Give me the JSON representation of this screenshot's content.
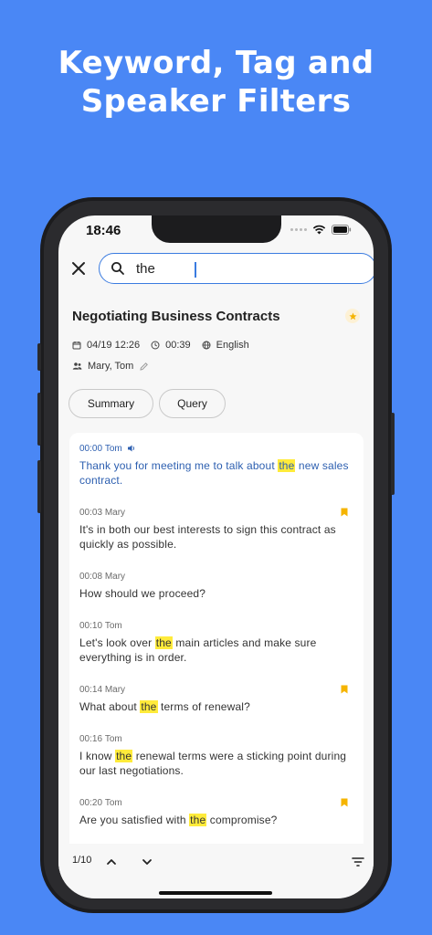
{
  "headline": {
    "line1": "Keyword, Tag and",
    "line2": "Speaker Filters"
  },
  "status_bar": {
    "time": "18:46"
  },
  "search": {
    "value": "the",
    "placeholder": ""
  },
  "document": {
    "title": "Negotiating Business Contracts",
    "date": "04/19 12:26",
    "duration": "00:39",
    "language": "English",
    "speakers": "Mary, Tom"
  },
  "tabs": [
    {
      "label": "Summary"
    },
    {
      "label": "Query"
    }
  ],
  "transcript": [
    {
      "time": "00:00",
      "speaker": "Tom",
      "pre": "Thank you for meeting me to talk about ",
      "match": "the",
      "post": " new sales contract.",
      "playing": true,
      "bookmarked": false
    },
    {
      "time": "00:03",
      "speaker": "Mary",
      "pre": "It's in both our best interests to sign this contract as quickly as possible.",
      "match": "",
      "post": "",
      "playing": false,
      "bookmarked": true
    },
    {
      "time": "00:08",
      "speaker": "Mary",
      "pre": "How should we proceed?",
      "match": "",
      "post": "",
      "playing": false,
      "bookmarked": false
    },
    {
      "time": "00:10",
      "speaker": "Tom",
      "pre": "Let's look over ",
      "match": "the",
      "post": " main articles and make sure everything is in order.",
      "playing": false,
      "bookmarked": false
    },
    {
      "time": "00:14",
      "speaker": "Mary",
      "pre": "What about ",
      "match": "the",
      "post": " terms of renewal?",
      "playing": false,
      "bookmarked": true
    },
    {
      "time": "00:16",
      "speaker": "Tom",
      "pre": "I know ",
      "match": "the",
      "post": " renewal terms were a sticking point during our last negotiations.",
      "playing": false,
      "bookmarked": false
    },
    {
      "time": "00:20",
      "speaker": "Tom",
      "pre": "Are you satisfied with ",
      "match": "the",
      "post": " compromise?",
      "playing": false,
      "bookmarked": true
    }
  ],
  "footer": {
    "page_counter": "1/10"
  },
  "colors": {
    "background": "#4a87f5",
    "accent": "#3a7be0",
    "highlight": "#ffeb3b",
    "bookmark": "#f5b400",
    "active_text": "#2d5fb0"
  }
}
